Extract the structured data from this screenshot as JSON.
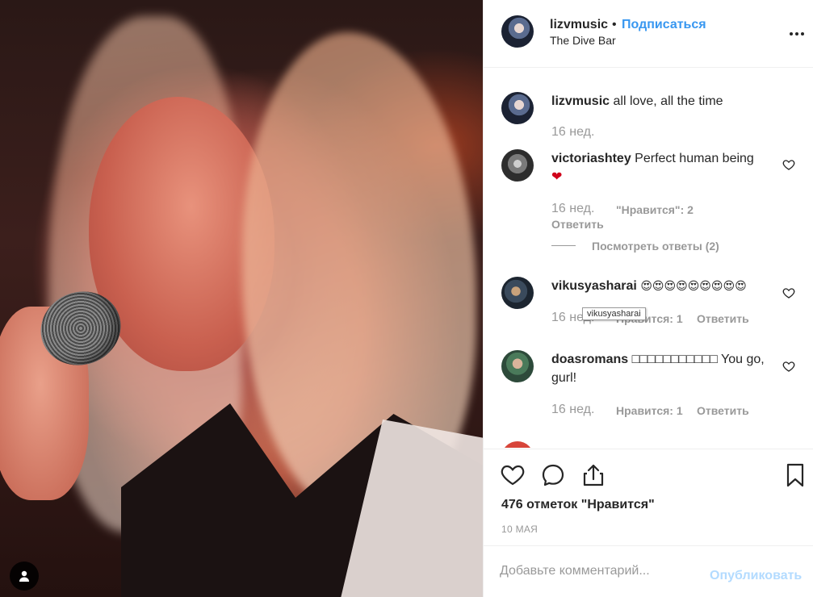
{
  "post": {
    "author": "lizvmusic",
    "separator": "•",
    "follow_label": "Подписаться",
    "location": "The Dive Bar"
  },
  "comments": [
    {
      "username": "lizvmusic",
      "text": "all love, all the time",
      "time": "16 нед."
    },
    {
      "username": "victoriashtey",
      "text": "Perfect human being",
      "emoji": "❤",
      "time": "16 нед.",
      "likes": "\"Нравится\": 2",
      "reply_label": "Ответить",
      "view_replies": "Посмотреть ответы (2)"
    },
    {
      "username": "vikusyasharai",
      "text": "😍😍😍😍😍😍😍😍😍",
      "time": "16 нед.",
      "likes": "Нравится: 1",
      "reply_label": "Ответить",
      "tooltip": "vikusyasharai"
    },
    {
      "username": "doasromans",
      "text": "□□□□□□□□□□□ You go, gurl!",
      "time": "16 нед.",
      "likes": "Нравится: 1",
      "reply_label": "Ответить"
    }
  ],
  "actions": {
    "like_icon": "heart-icon",
    "comment_icon": "comment-icon",
    "share_icon": "share-icon",
    "save_icon": "bookmark-icon"
  },
  "likes_count": "476 отметок \"Нравится\"",
  "date": "10 МАЯ",
  "add_comment": {
    "placeholder": "Добавьте комментарий...",
    "post_label": "Опубликовать"
  },
  "colors": {
    "link": "#3897f0",
    "text": "#262626",
    "muted": "#999999",
    "post_disabled": "#b3dbff",
    "heart": "#ed4956"
  }
}
